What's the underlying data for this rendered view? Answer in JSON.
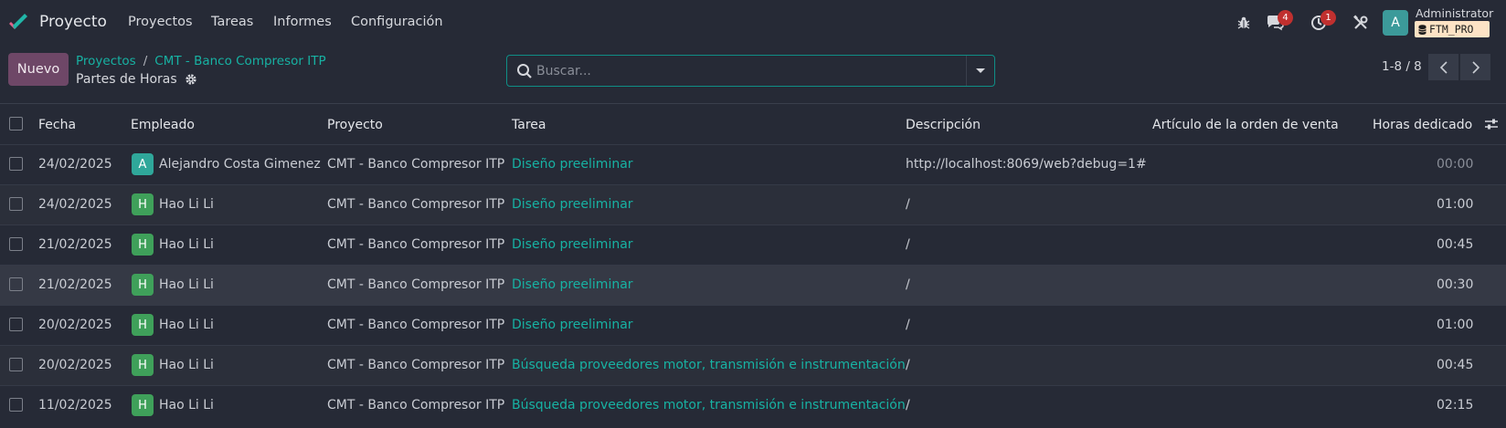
{
  "navbar": {
    "app_name": "Proyecto",
    "menu": [
      "Proyectos",
      "Tareas",
      "Informes",
      "Configuración"
    ],
    "messages_badge": "4",
    "activities_badge": "1",
    "user_initial": "A",
    "user_name": "Administrator",
    "database": "FTM_PRO",
    "icons": [
      "bug-icon",
      "chat-icon",
      "clock-icon",
      "tools-icon"
    ]
  },
  "control": {
    "new_button": "Nuevo",
    "breadcrumb": [
      "Proyectos",
      "CMT - Banco Compresor ITP"
    ],
    "breadcrumb_sep": "/",
    "page_title": "Partes de Horas",
    "search_placeholder": "Buscar...",
    "pager": "1-8 / 8"
  },
  "table": {
    "columns": [
      "Fecha",
      "Empleado",
      "Proyecto",
      "Tarea",
      "Descripción",
      "Artículo de la orden de venta",
      "Horas dedicado"
    ],
    "rows": [
      {
        "date": "24/02/2025",
        "employee": "Alejandro Costa Gimenez",
        "initial": "A",
        "avatar_color": "#2fa79a",
        "project": "CMT - Banco Compresor ITP",
        "task": "Diseño preeliminar",
        "description": "http://localhost:8069/web?debug=1#",
        "so_item": "",
        "hours": "00:00"
      },
      {
        "date": "24/02/2025",
        "employee": "Hao Li Li",
        "initial": "H",
        "avatar_color": "#3fa05a",
        "project": "CMT - Banco Compresor ITP",
        "task": "Diseño preeliminar",
        "description": "/",
        "so_item": "",
        "hours": "01:00"
      },
      {
        "date": "21/02/2025",
        "employee": "Hao Li Li",
        "initial": "H",
        "avatar_color": "#3fa05a",
        "project": "CMT - Banco Compresor ITP",
        "task": "Diseño preeliminar",
        "description": "/",
        "so_item": "",
        "hours": "00:45"
      },
      {
        "date": "21/02/2025",
        "employee": "Hao Li Li",
        "initial": "H",
        "avatar_color": "#3fa05a",
        "project": "CMT - Banco Compresor ITP",
        "task": "Diseño preeliminar",
        "description": "/",
        "so_item": "",
        "hours": "00:30"
      },
      {
        "date": "20/02/2025",
        "employee": "Hao Li Li",
        "initial": "H",
        "avatar_color": "#3fa05a",
        "project": "CMT - Banco Compresor ITP",
        "task": "Diseño preeliminar",
        "description": "/",
        "so_item": "",
        "hours": "01:00"
      },
      {
        "date": "20/02/2025",
        "employee": "Hao Li Li",
        "initial": "H",
        "avatar_color": "#3fa05a",
        "project": "CMT - Banco Compresor ITP",
        "task": "Búsqueda proveedores motor, transmisión e instrumentación",
        "description": "/",
        "so_item": "",
        "hours": "00:45"
      },
      {
        "date": "11/02/2025",
        "employee": "Hao Li Li",
        "initial": "H",
        "avatar_color": "#3fa05a",
        "project": "CMT - Banco Compresor ITP",
        "task": "Búsqueda proveedores motor, transmisión e instrumentación",
        "description": "/",
        "so_item": "",
        "hours": "02:15"
      }
    ]
  },
  "colors": {
    "accent": "#17b2a3",
    "primary_button": "#6e4767",
    "badge": "#c0302f",
    "background": "#262a36"
  }
}
